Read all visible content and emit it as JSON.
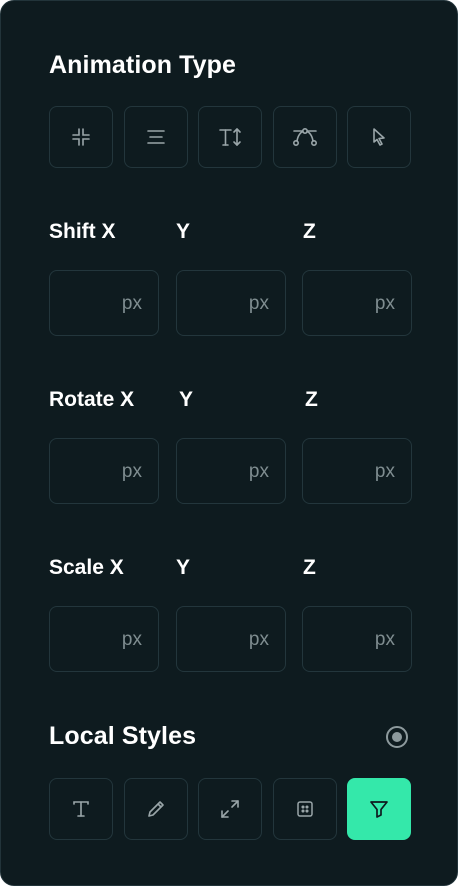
{
  "animation_type": {
    "title": "Animation Type",
    "buttons": [
      {
        "icon": "shrink-icon"
      },
      {
        "icon": "align-lines-icon"
      },
      {
        "icon": "text-height-icon"
      },
      {
        "icon": "bezier-curve-icon"
      },
      {
        "icon": "cursor-pointer-icon"
      }
    ]
  },
  "shift": {
    "label": "Shift X",
    "y_label": "Y",
    "z_label": "Z",
    "fields": [
      {
        "value": "",
        "unit": "px"
      },
      {
        "value": "",
        "unit": "px"
      },
      {
        "value": "",
        "unit": "px"
      }
    ]
  },
  "rotate": {
    "label": "Rotate X",
    "y_label": "Y",
    "z_label": "Z",
    "fields": [
      {
        "value": "",
        "unit": "px"
      },
      {
        "value": "",
        "unit": "px"
      },
      {
        "value": "",
        "unit": "px"
      }
    ]
  },
  "scale": {
    "label": "Scale X",
    "y_label": "Y",
    "z_label": "Z",
    "fields": [
      {
        "value": "",
        "unit": "px"
      },
      {
        "value": "",
        "unit": "px"
      },
      {
        "value": "",
        "unit": "px"
      }
    ]
  },
  "local_styles": {
    "title": "Local Styles",
    "buttons": [
      {
        "icon": "text-icon",
        "active": false
      },
      {
        "icon": "pencil-icon",
        "active": false
      },
      {
        "icon": "expand-arrows-icon",
        "active": false
      },
      {
        "icon": "grid-dots-icon",
        "active": false
      },
      {
        "icon": "filter-icon",
        "active": true
      }
    ]
  },
  "colors": {
    "background": "#0e1b1f",
    "border": "#23363c",
    "accent": "#34e8aa",
    "text": "#ffffff",
    "muted": "#7f8d90"
  }
}
